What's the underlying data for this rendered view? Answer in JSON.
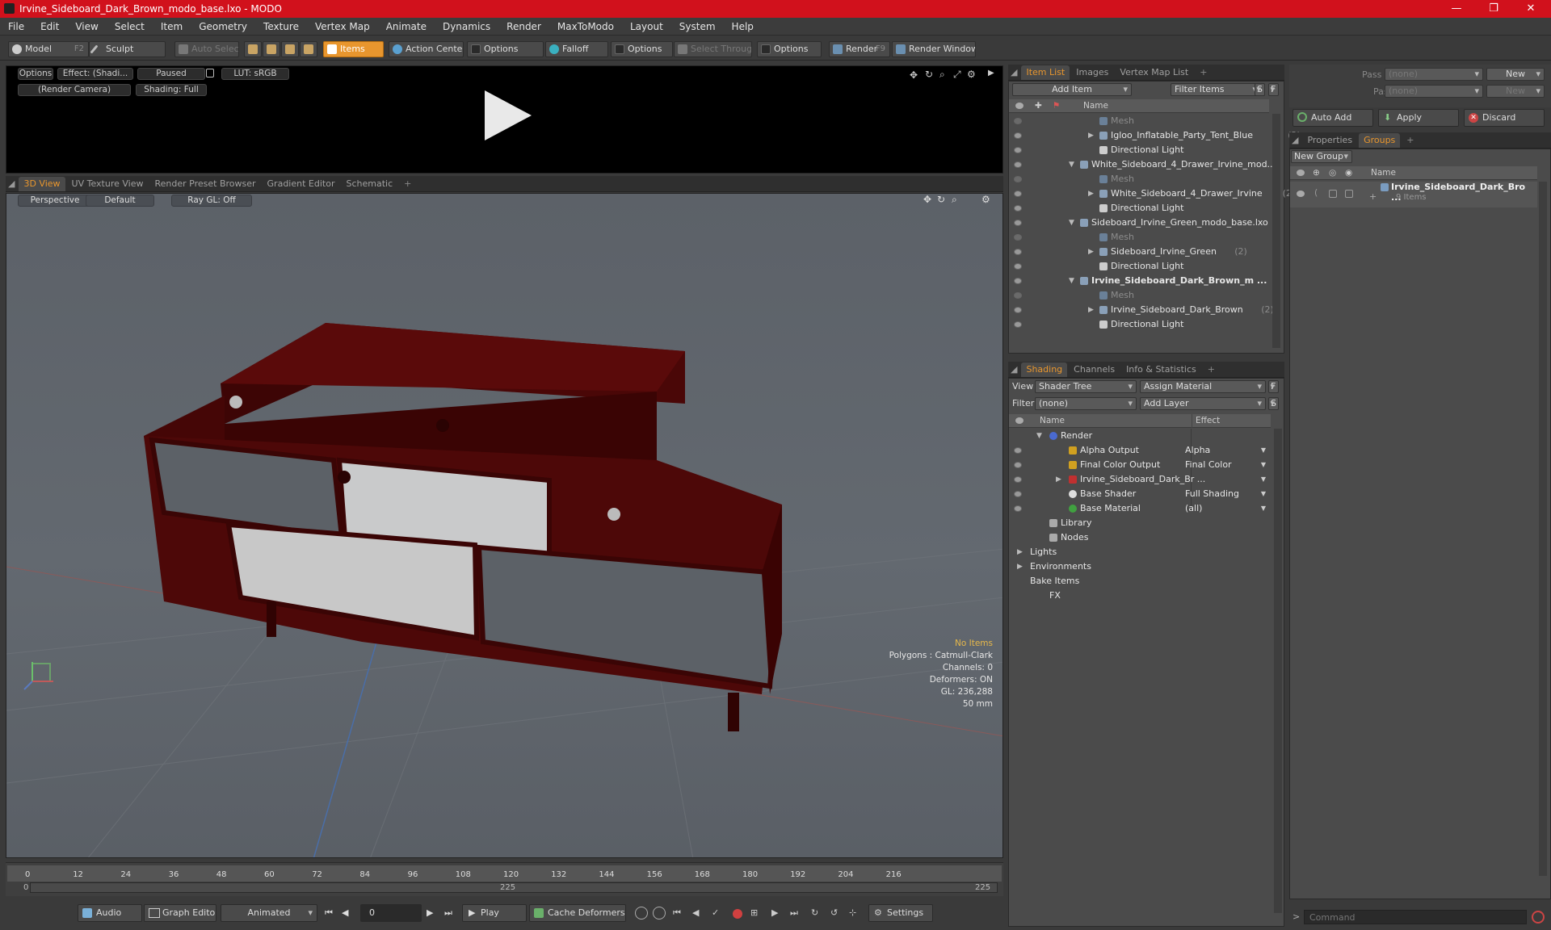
{
  "window": {
    "title": "Irvine_Sideboard_Dark_Brown_modo_base.lxo - MODO",
    "minimize": "—",
    "maximize": "❐",
    "close": "✕"
  },
  "menu": [
    "File",
    "Edit",
    "View",
    "Select",
    "Item",
    "Geometry",
    "Texture",
    "Vertex Map",
    "Animate",
    "Dynamics",
    "Render",
    "MaxToModo",
    "Layout",
    "System",
    "Help"
  ],
  "toolbar": {
    "model": "Model",
    "model_key": "F2",
    "sculpt": "Sculpt",
    "auto_select": "Auto Select",
    "items": "Items",
    "action_center": "Action Center",
    "options1": "Options",
    "falloff": "Falloff",
    "options2": "Options",
    "select_through": "Select Through",
    "options3": "Options",
    "render": "Render",
    "render_key": "F9",
    "render_window": "Render Window"
  },
  "preview": {
    "options": "Options",
    "effect": "Effect: (Shadi...",
    "paused": "Paused",
    "lut": "LUT: sRGB",
    "camera": "(Render Camera)",
    "shading": "Shading: Full"
  },
  "viewport_tabs": [
    "3D View",
    "UV Texture View",
    "Render Preset Browser",
    "Gradient Editor",
    "Schematic",
    "+"
  ],
  "viewport": {
    "perspective": "Perspective",
    "default": "Default",
    "raygl": "Ray GL: Off",
    "stats": {
      "no_items": "No Items",
      "polygons": "Polygons : Catmull-Clark",
      "channels": "Channels: 0",
      "deformers": "Deformers: ON",
      "gl": "GL: 236,288",
      "mm": "50 mm"
    }
  },
  "timeline": {
    "ticks": [
      "0",
      "12",
      "24",
      "36",
      "48",
      "60",
      "72",
      "84",
      "96",
      "108",
      "120",
      "132",
      "144",
      "156",
      "168",
      "180",
      "192",
      "204",
      "216"
    ],
    "start": "0",
    "mid": "225",
    "end": "225"
  },
  "bottom": {
    "audio": "Audio",
    "graph_editor": "Graph Editor",
    "animated": "Animated",
    "frame": "0",
    "play": "Play",
    "cache": "Cache Deformers",
    "settings": "Settings"
  },
  "item_list": {
    "tabs": [
      "Item List",
      "Images",
      "Vertex Map List",
      "+"
    ],
    "add_item": "Add Item",
    "filter": "Filter Items",
    "s": "S",
    "f": "F",
    "col_name": "Name",
    "rows": [
      {
        "label": "Mesh",
        "count": "",
        "dim": true
      },
      {
        "label": "Igloo_Inflatable_Party_Tent_Blue",
        "count": "(2)",
        "dim": false
      },
      {
        "label": "Directional Light",
        "count": "",
        "dim": false
      },
      {
        "label": "White_Sideboard_4_Drawer_Irvine_mod...",
        "count": "",
        "dim": false
      },
      {
        "label": "Mesh",
        "count": "",
        "dim": true
      },
      {
        "label": "White_Sideboard_4_Drawer_Irvine",
        "count": "(2)",
        "dim": false
      },
      {
        "label": "Directional Light",
        "count": "",
        "dim": false
      },
      {
        "label": "Sideboard_Irvine_Green_modo_base.lxo",
        "count": "",
        "dim": false
      },
      {
        "label": "Mesh",
        "count": "",
        "dim": true
      },
      {
        "label": "Sideboard_Irvine_Green",
        "count": "(2)",
        "dim": false
      },
      {
        "label": "Directional Light",
        "count": "",
        "dim": false
      },
      {
        "label": "Irvine_Sideboard_Dark_Brown_m ...",
        "count": "",
        "dim": false
      },
      {
        "label": "Mesh",
        "count": "",
        "dim": true
      },
      {
        "label": "Irvine_Sideboard_Dark_Brown",
        "count": "(2)",
        "dim": false
      },
      {
        "label": "Directional Light",
        "count": "",
        "dim": false
      }
    ]
  },
  "shading": {
    "tabs": [
      "Shading",
      "Channels",
      "Info & Statistics",
      "+"
    ],
    "view_label": "View",
    "view_value": "Shader Tree",
    "assign": "Assign Material",
    "f": "F",
    "filter_label": "Filter",
    "filter_value": "(none)",
    "add_layer": "Add Layer",
    "s": "S",
    "col_name": "Name",
    "col_effect": "Effect",
    "rows": [
      {
        "label": "Render",
        "effect": ""
      },
      {
        "label": "Alpha Output",
        "effect": "Alpha"
      },
      {
        "label": "Final Color Output",
        "effect": "Final Color"
      },
      {
        "label": "Irvine_Sideboard_Dark_Br ...",
        "effect": ""
      },
      {
        "label": "Base Shader",
        "effect": "Full Shading"
      },
      {
        "label": "Base Material",
        "effect": "(all)"
      },
      {
        "label": "Library",
        "effect": ""
      },
      {
        "label": "Nodes",
        "effect": ""
      },
      {
        "label": "Lights",
        "effect": ""
      },
      {
        "label": "Environments",
        "effect": ""
      },
      {
        "label": "Bake Items",
        "effect": ""
      },
      {
        "label": "FX",
        "effect": ""
      }
    ]
  },
  "groups": {
    "pass_groups_label": "Pass Groups",
    "pass_groups_value": "(none)",
    "new": "New",
    "passes_label": "Passes",
    "passes_value": "(none)",
    "new2": "New",
    "auto_add": "Auto Add",
    "apply": "Apply",
    "discard": "Discard",
    "tabs": [
      "Properties",
      "Groups",
      "+"
    ],
    "new_group": "New Group",
    "col_name": "Name",
    "item": "Irvine_Sideboard_Dark_Bro ...",
    "item_count": "9 Items"
  },
  "command": {
    "placeholder": "Command"
  }
}
